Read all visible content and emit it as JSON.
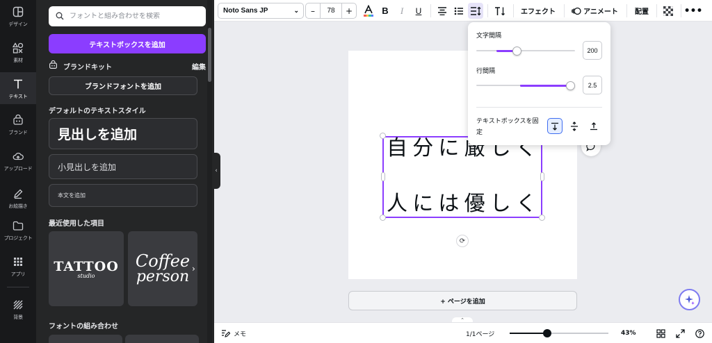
{
  "sidebar": {
    "items": [
      {
        "label": "デザイン",
        "icon": "layout-icon"
      },
      {
        "label": "素材",
        "icon": "shapes-icon"
      },
      {
        "label": "テキスト",
        "icon": "text-icon",
        "active": true
      },
      {
        "label": "ブランド",
        "icon": "brand-icon"
      },
      {
        "label": "アップロード",
        "icon": "cloud-upload-icon"
      },
      {
        "label": "お絵描き",
        "icon": "draw-icon"
      },
      {
        "label": "プロジェクト",
        "icon": "folder-icon"
      },
      {
        "label": "アプリ",
        "icon": "apps-grid-icon"
      },
      {
        "label": "背景",
        "icon": "background-pattern-icon"
      }
    ]
  },
  "text_panel": {
    "search_placeholder": "フォントと組み合わせを検索",
    "add_textbox_label": "テキストボックスを追加",
    "brand_kit_label": "ブランドキット",
    "brand_kit_edit": "編集",
    "add_brand_font_label": "ブランドフォントを追加",
    "default_styles_title": "デフォルトのテキストスタイル",
    "heading_label": "見出しを追加",
    "subheading_label": "小見出しを追加",
    "body_label": "本文を追加",
    "recent_title": "最近使用した項目",
    "recent_items": [
      {
        "text_main": "TATTOO",
        "text_sub": "studio"
      },
      {
        "text_main": "Coffee",
        "text_sub": "person"
      }
    ],
    "font_pairs_title": "フォントの組み合わせ"
  },
  "toolbar": {
    "font_family": "Noto Sans JP",
    "font_size": "78",
    "effects_label": "エフェクト",
    "animate_label": "アニメート",
    "position_label": "配置"
  },
  "canvas": {
    "text_line_1": "自分に厳しく",
    "text_line_2": "人には優しく",
    "add_page_label": "+ ページを追加"
  },
  "spacing_popover": {
    "letter_spacing_label": "文字間隔",
    "letter_spacing_value": "200",
    "line_spacing_label": "行間隔",
    "line_spacing_value": "2.5",
    "anchor_label": "テキストボックスを固定",
    "letter_spacing_fraction": 0.4,
    "line_spacing_fraction": 1.0
  },
  "bottombar": {
    "notes_label": "メモ",
    "page_indicator": "1/1ページ",
    "zoom_level": "43%",
    "zoom_fraction": 0.37
  },
  "colors": {
    "accent": "#8b3dff",
    "rail_bg": "#18191b",
    "panel_bg": "#252627"
  }
}
